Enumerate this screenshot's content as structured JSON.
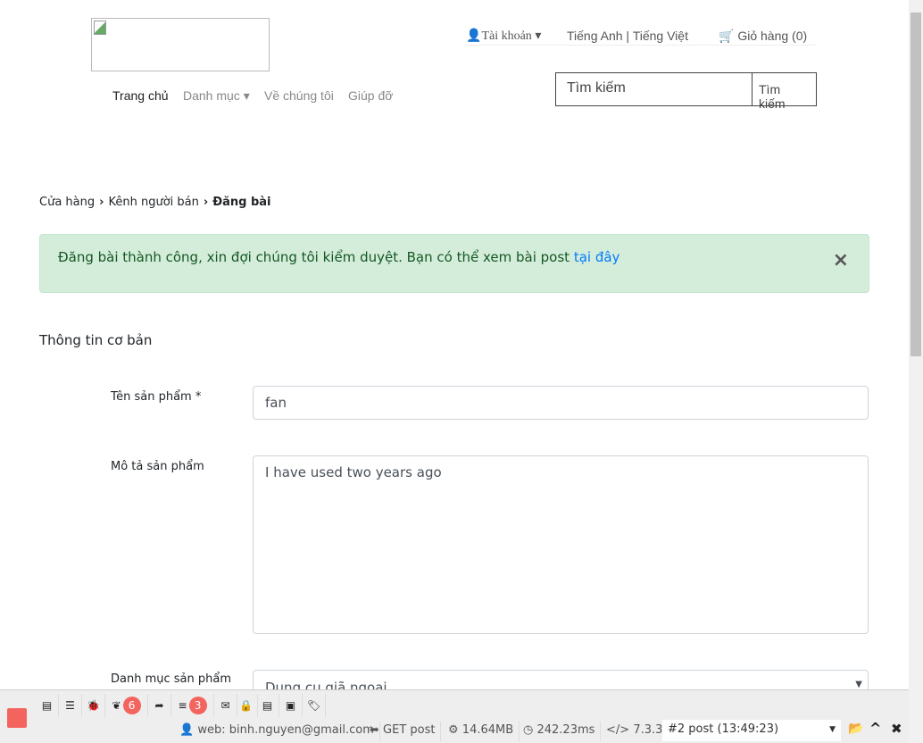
{
  "header": {
    "account": "Tài khoản",
    "language": "Tiếng Anh | Tiếng Việt",
    "cart": "Giỏ hàng (0)",
    "search_placeholder": "Tìm kiếm",
    "search_button": "Tìm kiếm"
  },
  "nav": {
    "home": "Trang chủ",
    "category": "Danh mục",
    "about": "Về chúng tôi",
    "help": "Giúp đỡ"
  },
  "breadcrumb": [
    "Cửa hàng",
    "Kênh người bán",
    "Đăng bài"
  ],
  "alert": {
    "text": "Đăng bài thành công, xin đợi chúng tôi kiểm duyệt. Bạn có thể xem bài post ",
    "link": "tại đây",
    "close": "×"
  },
  "form": {
    "section": "Thông tin cơ bản",
    "name_label": "Tên sản phẩm *",
    "name_value": "fan",
    "desc_label": "Mô tả sản phẩm",
    "desc_value": "I have used two years ago",
    "cat_label": "Danh mục sản phẩm",
    "cat_value": "Dụng cụ giã ngoại"
  },
  "debugbar": {
    "badge_messages": "6",
    "badge_queries": "3",
    "user": "web: binh.nguyen@gmail.com",
    "request": "GET post",
    "memory": "14.64MB",
    "time": "242.23ms",
    "php": "7.3.3",
    "selected_request": "#2 post (13:49:23)"
  }
}
